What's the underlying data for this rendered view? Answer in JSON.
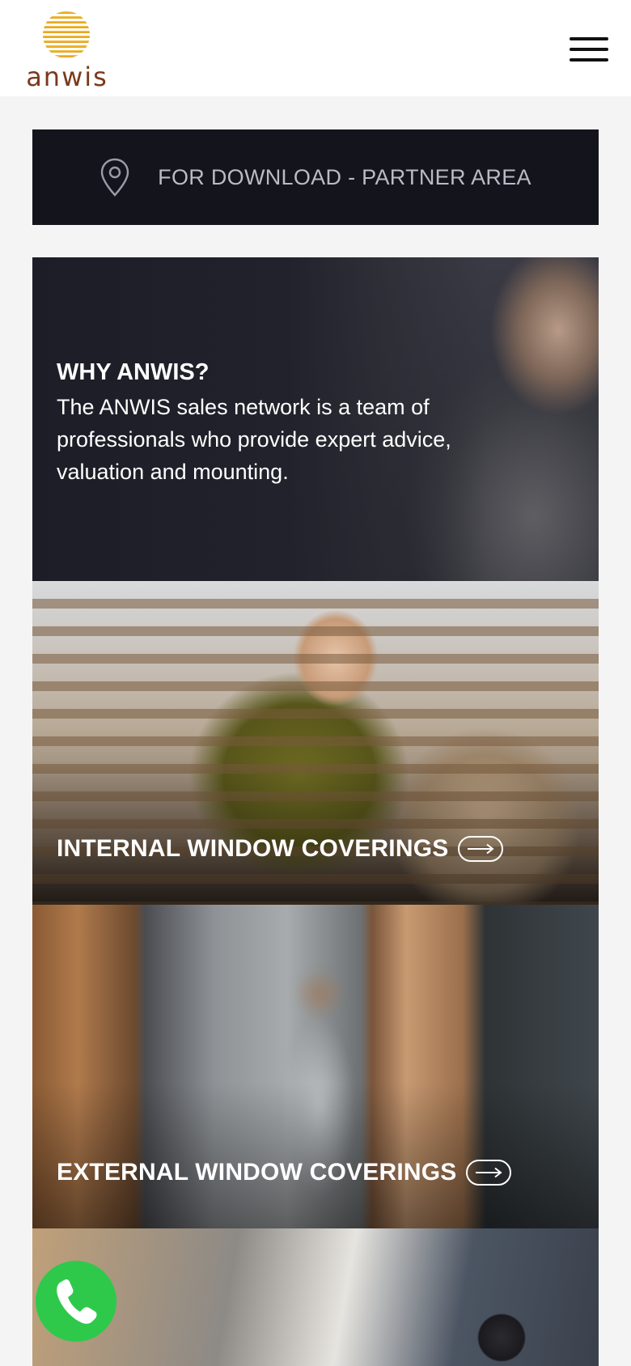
{
  "brand": {
    "name": "anwis",
    "logo_colors": [
      "#f2b92e",
      "#e59a1f",
      "#7a3a1c"
    ]
  },
  "header": {
    "menu_icon": "hamburger-icon"
  },
  "partner_area": {
    "icon": "location-pin-icon",
    "label": "FOR DOWNLOAD - PARTNER AREA"
  },
  "why": {
    "title": "WHY ANWIS?",
    "text": "The ANWIS sales network is a team of professionals who provide expert advice, valuation and mounting."
  },
  "categories": [
    {
      "label": "INTERNAL WINDOW COVERINGS",
      "icon": "arrow-right-icon"
    },
    {
      "label": "EXTERNAL WINDOW COVERINGS",
      "icon": "arrow-right-icon"
    }
  ],
  "call": {
    "icon": "phone-icon",
    "color": "#2ec94b"
  }
}
